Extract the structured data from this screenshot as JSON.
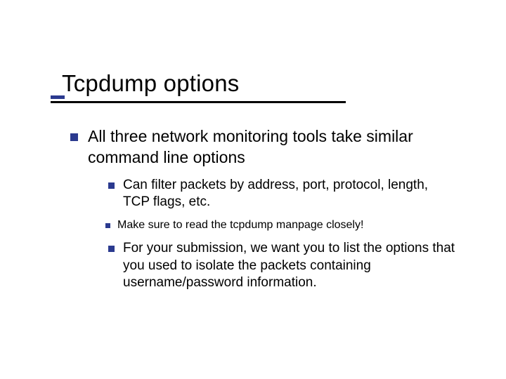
{
  "title": "Tcpdump options",
  "bullets": {
    "l1": "All three network monitoring tools take similar command line options",
    "l2a": "Can filter packets by address, port, protocol, length, TCP flags, etc.",
    "l3a": "Make sure to read the tcpdump manpage closely!",
    "l2b": "For your submission, we want you to list the options that you used to isolate the packets containing username/password information."
  }
}
